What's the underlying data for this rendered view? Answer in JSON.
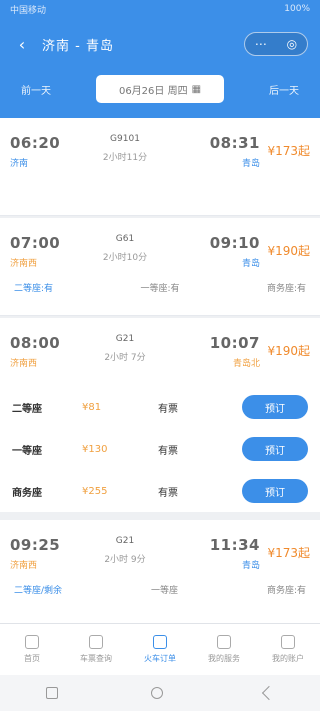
{
  "status_bar": {
    "left": "中国移动",
    "right": "100%"
  },
  "header": {
    "title": "济南 - 青岛"
  },
  "date_bar": {
    "prev": "前一天",
    "date": "06月26日 周四",
    "next": "后一天"
  },
  "trains": [
    {
      "dep_time": "06:20",
      "dep_station": "济南",
      "train_no": "G9101",
      "duration": "2小时11分",
      "arr_time": "08:31",
      "arr_station": "青岛",
      "price": "¥173起",
      "sub": [
        "",
        "",
        ""
      ]
    },
    {
      "dep_time": "07:00",
      "dep_station": "济南西",
      "train_no": "G61",
      "duration": "2小时10分",
      "arr_time": "09:10",
      "arr_station": "青岛",
      "price": "¥190起",
      "sub": [
        "二等座:有",
        "一等座:有",
        "商务座:有"
      ]
    },
    {
      "dep_time": "08:00",
      "dep_station": "济南西",
      "train_no": "G21",
      "duration": "2小时 7分",
      "arr_time": "10:07",
      "arr_station": "青岛北",
      "price": "¥190起",
      "sub": []
    },
    {
      "dep_time": "09:25",
      "dep_station": "济南西",
      "train_no": "G21",
      "duration": "2小时 9分",
      "arr_time": "11:34",
      "arr_station": "青岛",
      "price": "¥173起",
      "sub": [
        "二等座/剩余",
        "一等座",
        "商务座:有"
      ]
    }
  ],
  "seats": [
    {
      "name": "二等座",
      "price": "¥81",
      "avail": "有票",
      "button": "预订"
    },
    {
      "name": "一等座",
      "price": "¥130",
      "avail": "有票",
      "button": "预订"
    },
    {
      "name": "商务座",
      "price": "¥255",
      "avail": "有票",
      "button": "预订"
    }
  ],
  "bottom_nav": [
    {
      "label": "首页",
      "icon": "home-icon"
    },
    {
      "label": "车票查询",
      "icon": "search-icon"
    },
    {
      "label": "火车订单",
      "icon": "ticket-icon"
    },
    {
      "label": "我的服务",
      "icon": "service-icon"
    },
    {
      "label": "我的账户",
      "icon": "user-icon"
    }
  ],
  "colors": {
    "primary": "#3c8fe8",
    "accent": "#f08a2c"
  }
}
